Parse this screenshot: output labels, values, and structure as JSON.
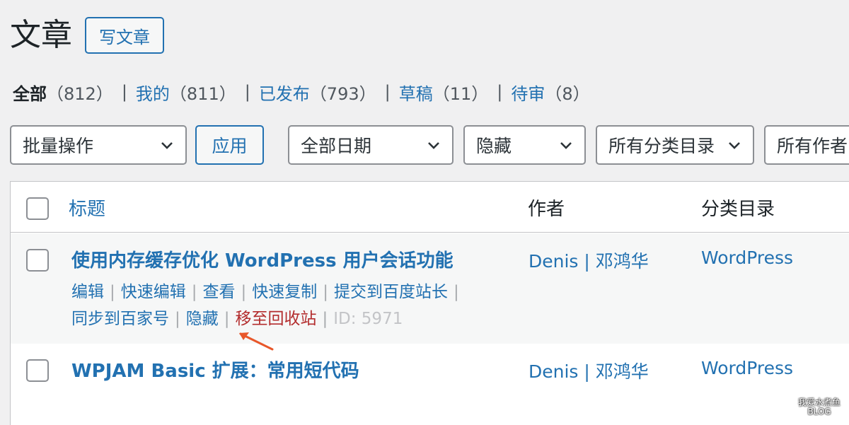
{
  "page": {
    "title": "文章",
    "add_new_label": "写文章"
  },
  "filters": [
    {
      "label": "全部",
      "count": "（812）",
      "current": true
    },
    {
      "label": "我的",
      "count": "（811）"
    },
    {
      "label": "已发布",
      "count": "（793）"
    },
    {
      "label": "草稿",
      "count": "（11）"
    },
    {
      "label": "待审",
      "count": "（8）"
    }
  ],
  "separator": "|",
  "toolbar": {
    "bulk_actions": "批量操作",
    "apply": "应用",
    "dates": "全部日期",
    "visibility": "隐藏",
    "categories": "所有分类目录",
    "authors": "所有作者"
  },
  "table": {
    "columns": {
      "title": "标题",
      "author": "作者",
      "categories": "分类目录"
    },
    "rows": [
      {
        "title": "使用内存缓存优化 WordPress 用户会话功能",
        "author": "Denis | 邓鸿华",
        "category": "WordPress",
        "actions": {
          "edit": "编辑",
          "quick_edit": "快速编辑",
          "view": "查看",
          "quick_copy": "快速复制",
          "submit_baidu": "提交到百度站长",
          "sync_baijia": "同步到百家号",
          "hide": "隐藏",
          "trash": "移至回收站",
          "id": "ID: 5971"
        }
      },
      {
        "title": "WPJAM Basic 扩展：常用短代码",
        "author": "Denis | 邓鸿华",
        "category": "WordPress"
      }
    ]
  },
  "watermark": {
    "line1": "我爱水煮鱼",
    "line2": "BLOG"
  },
  "colors": {
    "link": "#2271b1",
    "trash": "#b32d2e",
    "annotation_arrow": "#e8572a"
  }
}
